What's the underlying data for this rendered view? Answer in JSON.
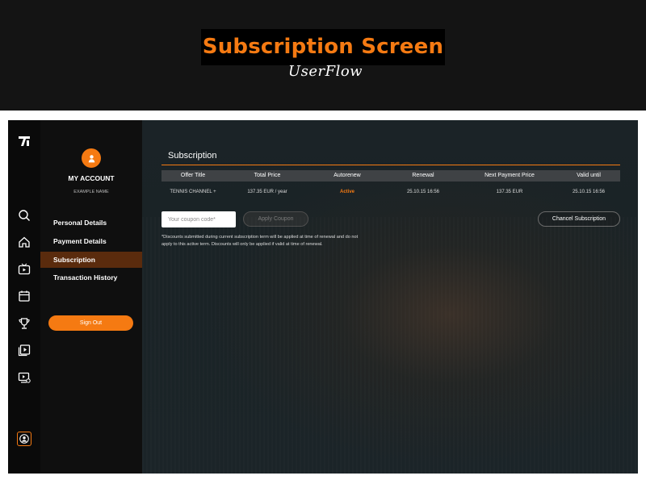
{
  "banner": {
    "title": "Subscription Screen",
    "subtitle": "UserFlow"
  },
  "colors": {
    "accent": "#f57a12",
    "active_menu": "#5a2b0d"
  },
  "rail": {
    "icons": [
      "logo-icon",
      "search-icon",
      "home-icon",
      "tv-icon",
      "calendar-icon",
      "trophy-icon",
      "video-library-icon",
      "live-tv-icon",
      "profile-icon"
    ]
  },
  "account": {
    "title": "MY ACCOUNT",
    "name": "EXAMPLE NAME",
    "menu": [
      {
        "label": "Personal Details",
        "active": false
      },
      {
        "label": "Payment Details",
        "active": false
      },
      {
        "label": "Subscription",
        "active": true
      },
      {
        "label": "Transaction History",
        "active": false
      }
    ],
    "signout": "Sign Out"
  },
  "subscription": {
    "title": "Subscription",
    "columns": [
      "Offer Title",
      "Total Price",
      "Autorenew",
      "Renewal",
      "Next Payment Price",
      "Valid until"
    ],
    "rows": [
      [
        "TENNIS CHANNEL +",
        "137.35 EUR / year",
        "Active",
        "25.10.15 16:56",
        "137.35 EUR",
        "25.10.15 16:56"
      ]
    ],
    "coupon_placeholder": "Your coupon code*",
    "apply_label": "Apply Coupon",
    "cancel_label": "Chancel Subscription",
    "note": "*Discounts submitted during current subscription term will be applied at time of renewal and do not apply to this active term. Discounts will only be applied if valid at time of renewal."
  }
}
